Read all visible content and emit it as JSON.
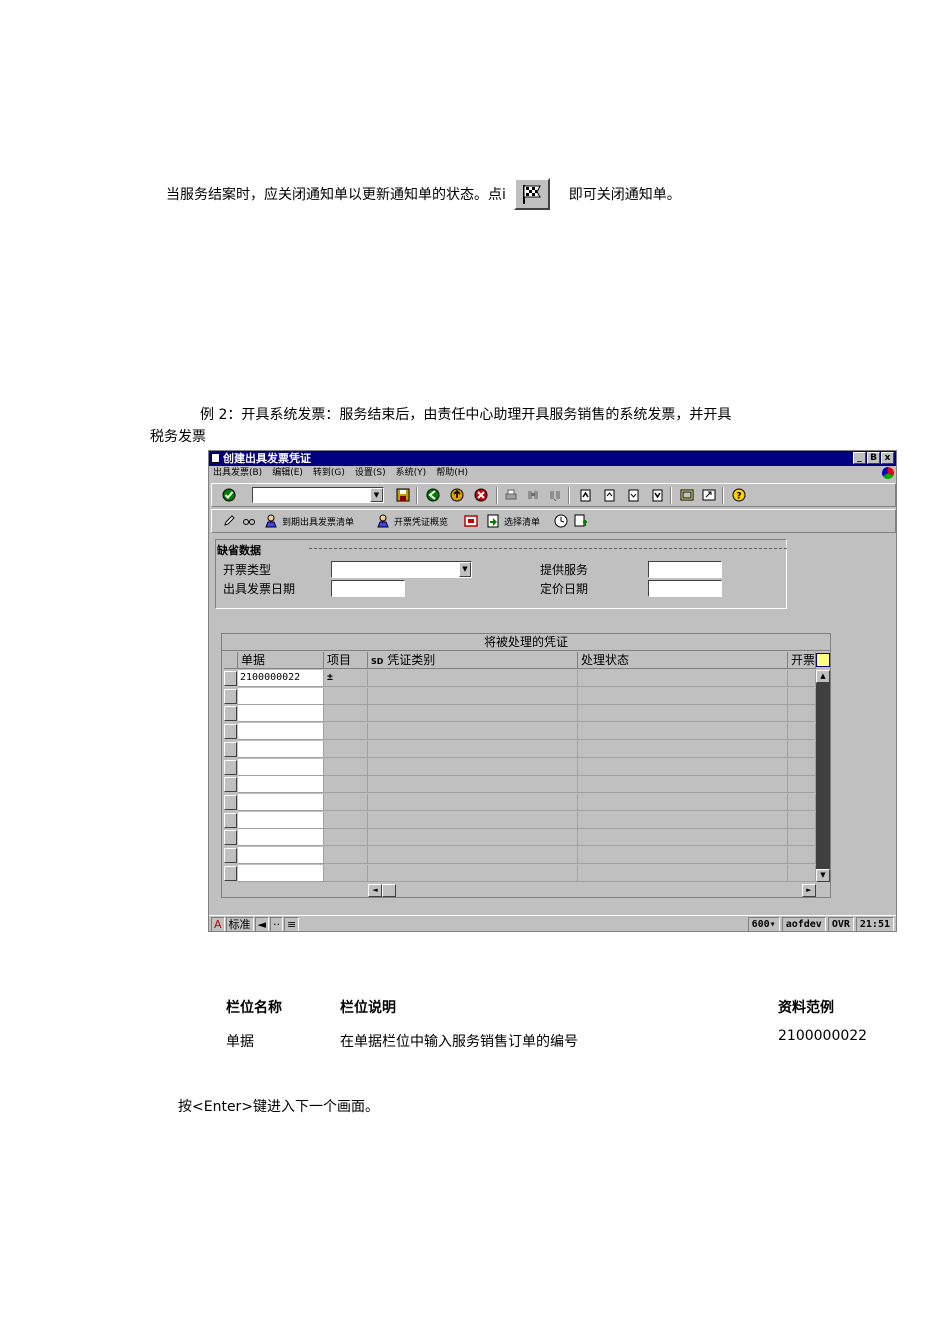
{
  "intro": {
    "p1_before": "当服务结案时，应关闭通知单以更新通知单的状态。点i",
    "p1_after": "即可关闭通知单。",
    "p2_line1": "例 2：开具系统发票：服务结束后，由责任中心助理开具服务销售的系统发票，并开具",
    "p2_line2": "税务发票"
  },
  "window": {
    "title": "创建出具发票凭证",
    "controls": [
      "_",
      "B",
      "x"
    ],
    "menu": [
      "出具发票(B)",
      "编辑(E)",
      "转到(G)",
      "设置(S)",
      "系统(Y)",
      "帮助(H)"
    ]
  },
  "toolbar2": {
    "due_list": "到期出具发票清单",
    "overview": "开票凭证概览",
    "select_list": "选择清单"
  },
  "defaults": {
    "group_title": "缺省数据",
    "billing_type": "开票类型",
    "billing_date": "出具发票日期",
    "service_date": "提供服务",
    "pricing_date": "定价日期"
  },
  "table": {
    "caption": "将被处理的凭证",
    "columns": [
      "单据",
      "项目",
      "凭证类别",
      "处理状态",
      "开票"
    ],
    "sd_prefix": "SD",
    "rows": [
      {
        "document": "2100000022",
        "item": "",
        "category": "",
        "status": ""
      }
    ],
    "row_count": 12
  },
  "statusbar": {
    "input_mode": "标准",
    "left_icons": [
      "A",
      "◄",
      "··",
      "≡"
    ],
    "system": "600▾",
    "server": "aofdev",
    "mode": "OVR",
    "time": "21:51"
  },
  "fields": {
    "headers": {
      "name": "栏位名称",
      "desc": "栏位说明",
      "example": "资料范例"
    },
    "row": {
      "name": "单据",
      "desc": "在单据栏位中输入服务销售订单的编号",
      "example": "2100000022"
    }
  },
  "footer": "按<Enter>键进入下一个画面。"
}
